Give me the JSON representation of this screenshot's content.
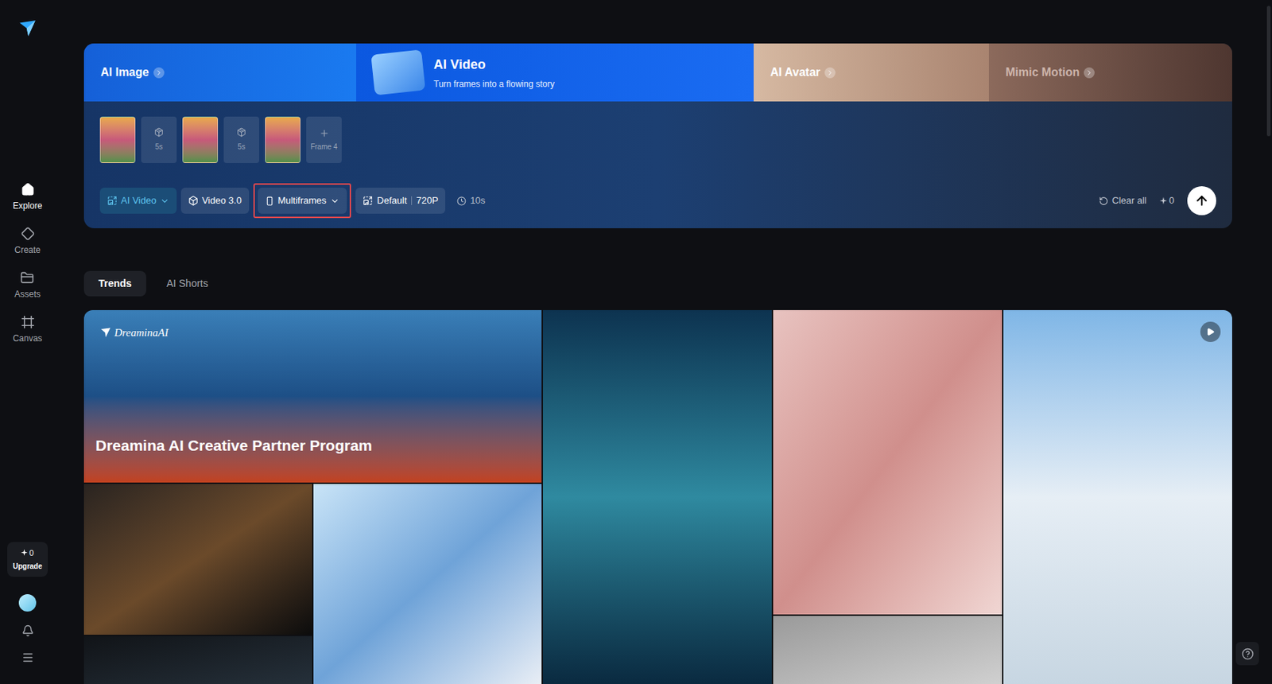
{
  "sidebar": {
    "items": [
      {
        "label": "Explore",
        "selected": true
      },
      {
        "label": "Create",
        "selected": false
      },
      {
        "label": "Assets",
        "selected": false
      },
      {
        "label": "Canvas",
        "selected": false
      }
    ],
    "credits": "0",
    "upgrade": "Upgrade"
  },
  "modes": [
    {
      "label": "AI Image",
      "subtitle": "",
      "selected": false
    },
    {
      "label": "AI Video",
      "subtitle": "Turn frames into a flowing story",
      "selected": true
    },
    {
      "label": "AI Avatar",
      "subtitle": "",
      "selected": false
    },
    {
      "label": "Mimic Motion",
      "subtitle": "",
      "selected": false
    }
  ],
  "frames": [
    {
      "kind": "image",
      "label": ""
    },
    {
      "kind": "duration",
      "label": "5s"
    },
    {
      "kind": "image",
      "label": ""
    },
    {
      "kind": "duration",
      "label": "5s"
    },
    {
      "kind": "image",
      "label": ""
    },
    {
      "kind": "add",
      "label": "Frame 4"
    }
  ],
  "toolbar": {
    "mode": "AI Video",
    "model": "Video 3.0",
    "type": "Multiframes",
    "type_highlighted": true,
    "ratio": "Default",
    "resolution": "720P",
    "duration": "10s",
    "clear": "Clear all",
    "credits": "0"
  },
  "feed_tabs": [
    {
      "label": "Trends",
      "selected": true
    },
    {
      "label": "AI Shorts",
      "selected": false
    }
  ],
  "gallery": {
    "cards": [
      {
        "title": "Dreamina AI Creative Partner Program",
        "brand": "DreaminaAI",
        "video": false
      },
      {
        "title": "",
        "brand": "",
        "video": false
      },
      {
        "title": "",
        "brand": "",
        "video": false
      },
      {
        "title": "",
        "brand": "",
        "video": false
      },
      {
        "title": "",
        "brand": "",
        "video": false
      },
      {
        "title": "",
        "brand": "",
        "video": false
      },
      {
        "title": "",
        "brand": "",
        "video": true
      },
      {
        "title": "",
        "brand": "",
        "video": false
      }
    ]
  }
}
